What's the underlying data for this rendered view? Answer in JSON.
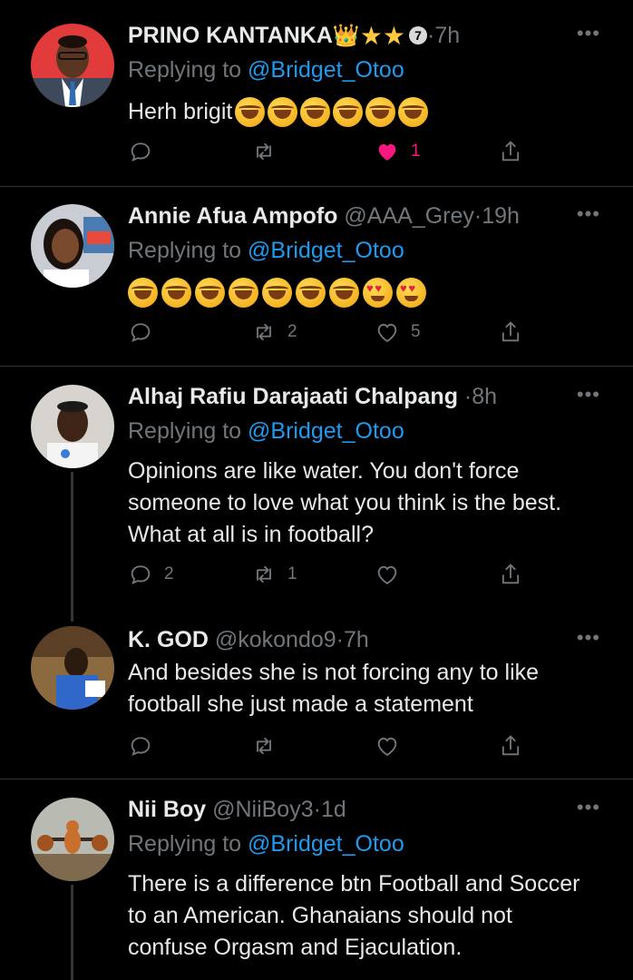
{
  "tweets": [
    {
      "name": "PRINO KANTANKA",
      "badge_number": "7",
      "handle": "",
      "time": "7h",
      "replying_label": "Replying to",
      "mention": "@Bridget_Otoo",
      "text": "Herh brigit",
      "emojis": [
        "rofl",
        "rofl",
        "rofl",
        "rofl",
        "rofl",
        "rofl"
      ],
      "reply_count": "",
      "retweet_count": "",
      "like_count": "1",
      "liked": true
    },
    {
      "name": "Annie Afua Ampofo",
      "handle": "@AAA_Grey",
      "time": "19h",
      "replying_label": "Replying to",
      "mention": "@Bridget_Otoo",
      "emojis": [
        "rofl",
        "rofl",
        "rofl",
        "rofl",
        "rofl",
        "rofl",
        "rofl",
        "heart-eyes",
        "heart-eyes"
      ],
      "reply_count": "",
      "retweet_count": "2",
      "like_count": "5"
    },
    {
      "name": "Alhaj Rafiu Darajaati Chalpang",
      "handle": "",
      "time": "8h",
      "replying_label": "Replying to",
      "mention": "@Bridget_Otoo",
      "text": "Opinions are like water. You don't force someone to love what you think is the best. What at all is in football?",
      "reply_count": "2",
      "retweet_count": "1",
      "like_count": ""
    },
    {
      "name": "K. GOD",
      "handle": "@kokondo9",
      "time": "7h",
      "text": "And besides she is not forcing any to like football she just made a statement",
      "reply_count": "",
      "retweet_count": "",
      "like_count": ""
    },
    {
      "name": "Nii Boy",
      "handle": "@NiiBoy3",
      "time": "1d",
      "replying_label": "Replying to",
      "mention": "@Bridget_Otoo",
      "text": "There is a difference btn Football and Soccer to an American. Ghanaians should not confuse Orgasm and Ejaculation."
    }
  ],
  "separator_dot": "·",
  "more_label": "•••",
  "colors": {
    "background": "#000000",
    "secondary_text": "#71767b",
    "mention": "#1d9bf0",
    "like_active": "#f91880",
    "separator": "#2f3336"
  }
}
